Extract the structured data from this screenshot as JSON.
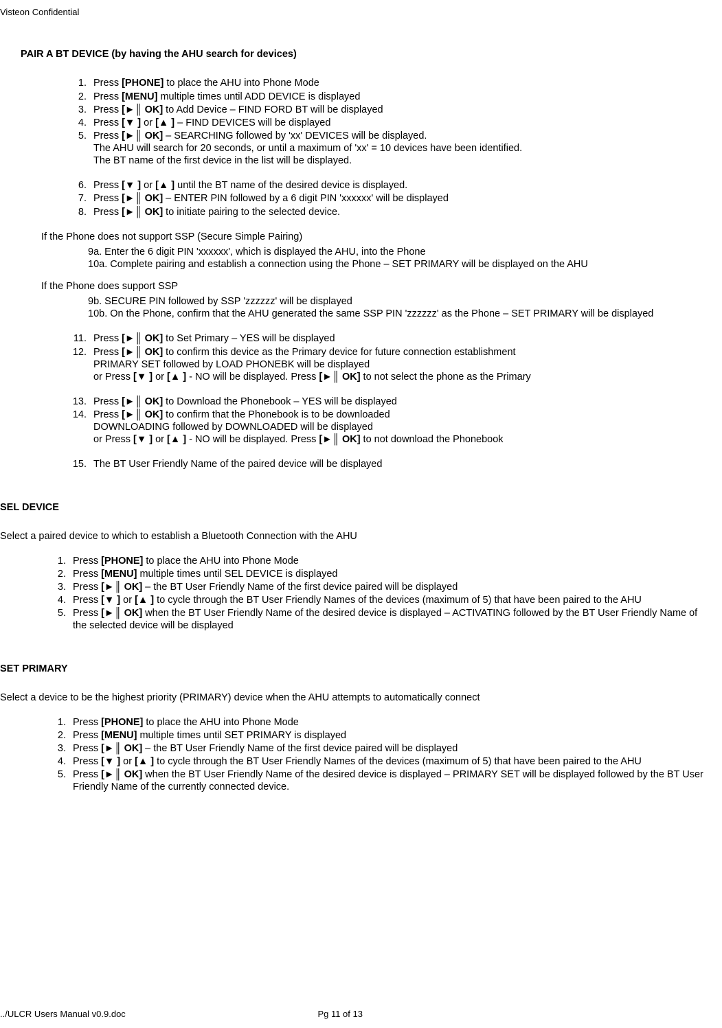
{
  "header": "Visteon Confidential",
  "footer_left": "../ULCR Users Manual v0.9.doc",
  "footer_mid": "Pg 11 of 13",
  "pair": {
    "title": "PAIR A BT DEVICE (by having the AHU search for devices)",
    "s1a": "Press ",
    "s1k": "[PHONE]",
    "s1b": " to place the AHU into Phone Mode",
    "s2a": "Press ",
    "s2k": "[MENU]",
    "s2b": " multiple times until ADD DEVICE is displayed",
    "s3a": "Press ",
    "s3k": "[►║ OK]",
    "s3b": " to Add Device – FIND FORD BT will be displayed",
    "s4a": "Press ",
    "s4k1": "[▼ ]",
    "s4m": " or ",
    "s4k2": "[▲ ]",
    "s4b": " – FIND DEVICES will be displayed",
    "s5a": "Press ",
    "s5k": "[►║ OK]",
    "s5b": " – SEARCHING followed by 'xx' DEVICES will be displayed.",
    "s5c": "The AHU will search for 20 seconds, or until a maximum of 'xx' = 10 devices have been identified.",
    "s5d": "The BT name of the first device in the list will be displayed.",
    "s6a": "Press ",
    "s6k1": "[▼ ]",
    "s6m": " or ",
    "s6k2": "[▲ ]",
    "s6b": " until the BT name of the desired device is displayed.",
    "s7a": "Press ",
    "s7k": "[►║ OK]",
    "s7b": " – ENTER PIN followed by a 6 digit PIN 'xxxxxx' will be displayed",
    "s8a": "Press ",
    "s8k": "[►║ OK]",
    "s8b": " to initiate pairing to the selected device.",
    "nossp_title": "If the Phone does not support SSP (Secure Simple Pairing)",
    "nossp_9a": "9a.   Enter the 6 digit PIN 'xxxxxx', which is displayed the AHU, into the Phone",
    "nossp_10a": "10a.  Complete pairing and establish a connection using the Phone – SET PRIMARY will be displayed on the AHU",
    "ssp_title": "If the Phone does support SSP",
    "ssp_9b": "9b.   SECURE PIN followed by SSP 'zzzzzz' will be displayed",
    "ssp_10b": "10b.  On the Phone, confirm that the AHU generated the same SSP PIN 'zzzzzz' as the Phone – SET PRIMARY will be displayed",
    "s11a": "Press ",
    "s11k": "[►║ OK]",
    "s11b": " to Set Primary – YES will be displayed",
    "s12a": "Press ",
    "s12k": "[►║ OK]",
    "s12b": " to confirm this device as the Primary device for future connection establishment",
    "s12c": "PRIMARY SET followed by LOAD PHONEBK will be displayed",
    "s12da": "or Press ",
    "s12dk1": "[▼ ]",
    "s12dm": " or ",
    "s12dk2": "[▲ ]",
    "s12db": " - NO will be displayed.  Press ",
    "s12dk3": "[►║ OK]",
    "s12dc": " to not select the phone as the Primary",
    "s13a": "Press ",
    "s13k": "[►║ OK]",
    "s13b": " to Download the Phonebook – YES will be displayed",
    "s14a": "Press ",
    "s14k": "[►║ OK]",
    "s14b": " to confirm that the Phonebook is to be downloaded",
    "s14c": "DOWNLOADING followed by DOWNLOADED will be displayed",
    "s14da": "or Press ",
    "s14dk1": "[▼ ]",
    "s14dm": " or ",
    "s14dk2": "[▲ ]",
    "s14db": " - NO will be displayed.  Press ",
    "s14dk3": "[►║ OK]",
    "s14dc": " to not download the Phonebook",
    "s15": "The BT User Friendly Name of the paired device will be displayed"
  },
  "sel": {
    "title": "SEL DEVICE",
    "intro": "Select a paired device to which to establish a Bluetooth Connection with the AHU",
    "s1a": "Press ",
    "s1k": "[PHONE]",
    "s1b": " to place the AHU into Phone Mode",
    "s2a": "Press ",
    "s2k": "[MENU]",
    "s2b": " multiple times until SEL DEVICE is displayed",
    "s3a": "Press ",
    "s3k": "[►║ OK]",
    "s3b": " – the BT User Friendly Name of the first device paired will be displayed",
    "s4a": "Press ",
    "s4k1": "[▼ ]",
    "s4m": " or ",
    "s4k2": "[▲ ]",
    "s4b": " to cycle through the BT User Friendly Names of the devices (maximum of 5) that have been paired to the AHU",
    "s5a": "Press ",
    "s5k": "[►║ OK]",
    "s5b": " when the BT User Friendly Name of the desired device is displayed – ACTIVATING followed by the BT User Friendly Name of the selected device will be displayed"
  },
  "set": {
    "title": "SET PRIMARY",
    "intro": "Select a device to be the highest priority (PRIMARY) device when the AHU attempts to automatically connect",
    "s1a": "Press ",
    "s1k": "[PHONE]",
    "s1b": " to place the AHU into Phone Mode",
    "s2a": "Press ",
    "s2k": "[MENU]",
    "s2b": " multiple times until SET PRIMARY is displayed",
    "s3a": "Press ",
    "s3k": "[►║ OK]",
    "s3b": " – the BT User Friendly Name of the first device paired will be displayed",
    "s4a": "Press ",
    "s4k1": "[▼ ]",
    "s4m": " or ",
    "s4k2": "[▲ ]",
    "s4b": " to cycle through the BT User Friendly Names of the devices (maximum of 5) that have been paired to the AHU",
    "s5a": "Press ",
    "s5k": "[►║ OK]",
    "s5b": " when the BT User Friendly Name of the desired device is displayed – PRIMARY SET will be displayed followed by the BT User Friendly Name of the currently connected device."
  }
}
